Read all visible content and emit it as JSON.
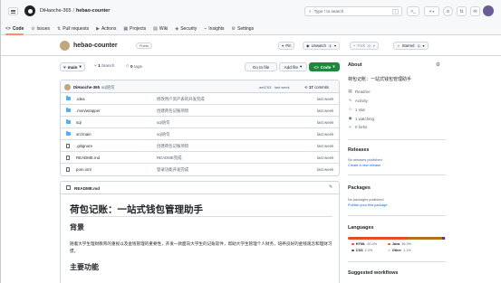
{
  "header": {
    "owner": "DiHaoche-365",
    "separator": "/",
    "repo": "hebao-counter",
    "search_placeholder": "Type / to search",
    "search_kbd": "/",
    "terminal_glyph": ">_",
    "plus_glyph": "+",
    "chevron_glyph": "▾",
    "issues_glyph": "⊙",
    "pr_glyph": "⇅",
    "inbox_glyph": "✉"
  },
  "nav": {
    "tabs": [
      {
        "label": "Code",
        "icon": "code-icon",
        "glyph": "<>"
      },
      {
        "label": "Issues",
        "icon": "issue-icon",
        "glyph": "⊙"
      },
      {
        "label": "Pull requests",
        "icon": "pull-request-icon",
        "glyph": "⇅"
      },
      {
        "label": "Actions",
        "icon": "play-icon",
        "glyph": "▶"
      },
      {
        "label": "Projects",
        "icon": "table-icon",
        "glyph": "▦"
      },
      {
        "label": "Wiki",
        "icon": "book-icon",
        "glyph": "▤"
      },
      {
        "label": "Security",
        "icon": "shield-icon",
        "glyph": "◈"
      },
      {
        "label": "Insights",
        "icon": "graph-icon",
        "glyph": "⌁"
      },
      {
        "label": "Settings",
        "icon": "gear-icon",
        "glyph": "⚙"
      }
    ]
  },
  "repo_header": {
    "title": "hebao-counter",
    "visibility": "Public",
    "pin_label": "Pin",
    "unwatch_label": "Unwatch",
    "unwatch_count": "1",
    "fork_label": "Fork",
    "fork_count": "0",
    "starred_label": "Starred",
    "starred_count": "1"
  },
  "branch_bar": {
    "branch": "main",
    "branches_count": "1",
    "branches_label": "branch",
    "tags_count": "0",
    "tags_label": "tags",
    "goto_label": "Go to file",
    "addfile_label": "Add file",
    "code_label": "Code"
  },
  "latest_commit": {
    "user": "DiHaoche-365",
    "message": "sql语句",
    "hash": "ae6763",
    "time": "last week",
    "commits_count": "17",
    "commits_label": "commits"
  },
  "files": [
    {
      "name": ".idea",
      "type": "folder",
      "message": "修改用户资产表的开发完成",
      "time": "last week"
    },
    {
      "name": ".mvn/wrapper",
      "type": "folder",
      "message": "创建荷包记账项目",
      "time": "last week"
    },
    {
      "name": "sql",
      "type": "folder",
      "message": "sql语句",
      "time": "last week"
    },
    {
      "name": "src/main",
      "type": "folder",
      "message": "sql语句",
      "time": "last week"
    },
    {
      "name": ".gitignore",
      "type": "file",
      "message": "创建荷包记账项目",
      "time": "last week"
    },
    {
      "name": "README.md",
      "type": "file",
      "message": "README完成",
      "time": "last week"
    },
    {
      "name": "pom.xml",
      "type": "file",
      "message": "登录功能开发完成",
      "time": "last week"
    }
  ],
  "readme": {
    "label": "README.md",
    "h1": "荷包记账：一站式钱包管理助手",
    "h2_background": "背景",
    "paragraph": "随着大学生理财教育的重视以及金钱管理的重要性，开发一款面向大学生的记账软件，帮助大学生管理个人财务，培养良好的金钱观念和理财习惯。",
    "h2_features": "主要功能"
  },
  "sidebar": {
    "about_title": "About",
    "description": "荷包记账：一站式钱包管理助手",
    "links": [
      {
        "label": "Readme",
        "icon": "book-icon",
        "glyph": "▤"
      },
      {
        "label": "Activity",
        "icon": "pulse-icon",
        "glyph": "∿"
      },
      {
        "label": "1 star",
        "icon": "star-icon",
        "glyph": "☆"
      },
      {
        "label": "1 watching",
        "icon": "eye-icon",
        "glyph": "◉"
      },
      {
        "label": "0 forks",
        "icon": "fork-icon",
        "glyph": "⑂"
      }
    ],
    "releases_title": "Releases",
    "releases_note": "No releases published",
    "releases_link": "Create a new release",
    "packages_title": "Packages",
    "packages_note": "No packages published",
    "packages_link": "Publish your first package",
    "languages_title": "Languages",
    "languages": [
      {
        "name": "HTML",
        "pct": "60.4%",
        "color": "#e34c26",
        "share": 60.4
      },
      {
        "name": "Java",
        "pct": "36.3%",
        "color": "#b07219",
        "share": 36.3
      },
      {
        "name": "CSS",
        "pct": "2.2%",
        "color": "#563d7c",
        "share": 2.2
      },
      {
        "name": "Other",
        "pct": "1.1%",
        "color": "#d0d7de",
        "share": 1.1
      }
    ],
    "workflows_title": "Suggested workflows"
  }
}
